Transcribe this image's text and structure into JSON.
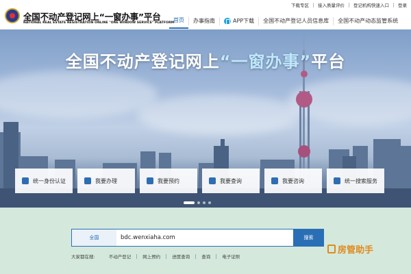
{
  "header": {
    "site_title": "全国不动产登记网上“一窗办事”平台",
    "site_subtitle": "NATIONAL REAL ESTATE REGISTRATION ONLINE \"ONE WINDOW SERVICE\" PLATFORM",
    "top_links": [
      "下载专区",
      "接入质量评价",
      "登记机构快速入口",
      "登录"
    ],
    "nav": [
      "首页",
      "办事指南",
      "APP下载",
      "全国不动产登记人员信息库",
      "全国不动产动态监管系统"
    ]
  },
  "hero": {
    "title_pre": "全国不动产登记网上",
    "title_hl": "“一窗办事”",
    "title_post": "平台",
    "services": [
      "统一身份认证",
      "我要办理",
      "我要预约",
      "我要查询",
      "我要咨询",
      "统一搜索服务"
    ],
    "carousel_pages": 4,
    "carousel_active": 1
  },
  "search": {
    "scope": "全国",
    "query": "bdc.wenxiaha.com",
    "button": "搜索",
    "hot_label": "大家都在搜:",
    "hot_keywords": [
      "不动产登记",
      "网上预约",
      "进度查询",
      "查询",
      "电子证照"
    ]
  },
  "watermark": "房管助手",
  "colors": {
    "accent": "#2a6fb5",
    "background_bottom": "#d4e9dc",
    "watermark": "#e08a1e"
  }
}
